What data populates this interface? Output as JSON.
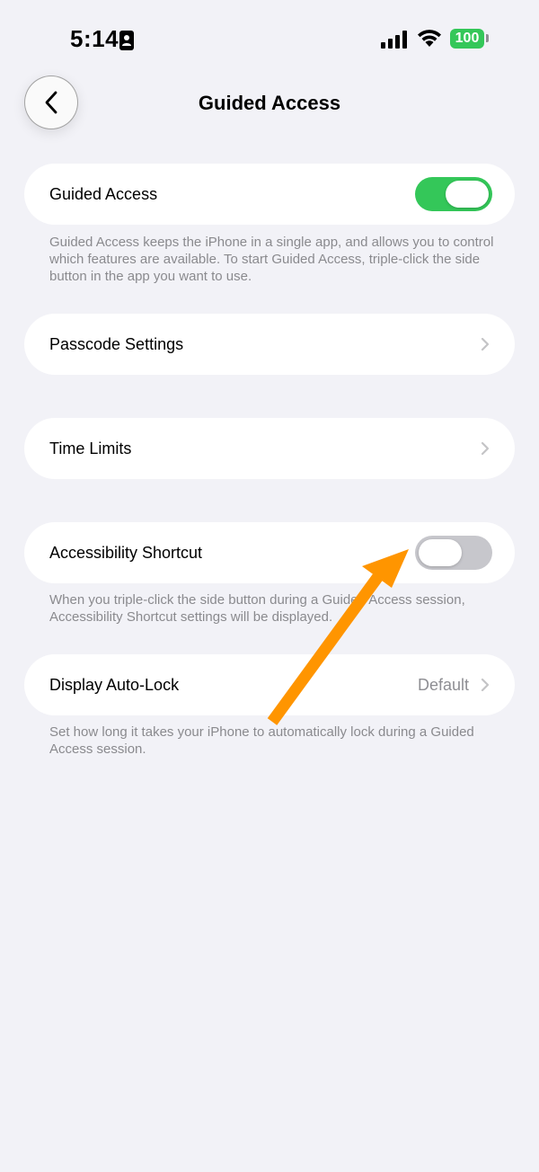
{
  "status_bar": {
    "time": "5:14",
    "battery": "100"
  },
  "nav": {
    "title": "Guided Access"
  },
  "settings": {
    "guided_access": {
      "label": "Guided Access",
      "enabled": true,
      "footnote": "Guided Access keeps the iPhone in a single app, and allows you to control which features are available. To start Guided Access, triple-click the side button in the app you want to use."
    },
    "passcode_settings": {
      "label": "Passcode Settings"
    },
    "time_limits": {
      "label": "Time Limits"
    },
    "accessibility_shortcut": {
      "label": "Accessibility Shortcut",
      "enabled": false,
      "footnote": "When you triple-click the side button during a Guided Access session, Accessibility Shortcut settings will be displayed."
    },
    "display_auto_lock": {
      "label": "Display Auto-Lock",
      "value": "Default",
      "footnote": "Set how long it takes your iPhone to automatically lock during a Guided Access session."
    }
  },
  "colors": {
    "toggle_on": "#34c759",
    "toggle_off": "#c7c7cc",
    "annotation_arrow": "#ff9500"
  }
}
